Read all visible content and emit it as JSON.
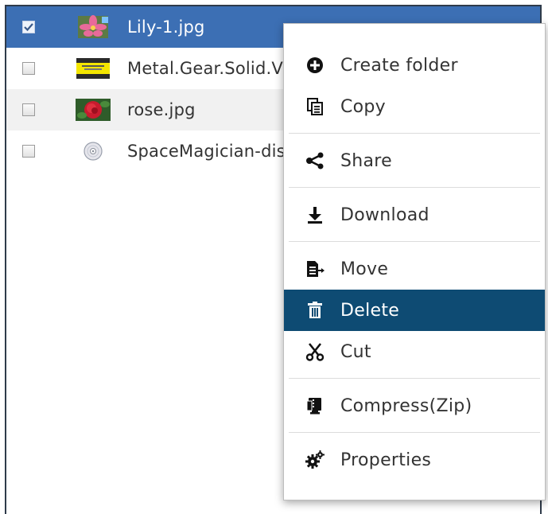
{
  "files": [
    {
      "name": "Lily-1.jpg",
      "checked": true,
      "thumb": "lily-photo-thumbnail"
    },
    {
      "name": "Metal.Gear.Solid.V",
      "checked": false,
      "thumb": "metal-gear-cover-thumbnail"
    },
    {
      "name": "rose.jpg",
      "checked": false,
      "thumb": "rose-photo-thumbnail"
    },
    {
      "name": "SpaceMagician-disc",
      "checked": false,
      "thumb": "disc-icon"
    }
  ],
  "menu": {
    "create_folder": "Create folder",
    "copy": "Copy",
    "share": "Share",
    "download": "Download",
    "move": "Move",
    "delete": "Delete",
    "cut": "Cut",
    "compress": "Compress(Zip)",
    "properties": "Properties"
  },
  "colors": {
    "selected_row": "#3c6fb4",
    "menu_highlight": "#0e4b73",
    "text": "#333333"
  }
}
